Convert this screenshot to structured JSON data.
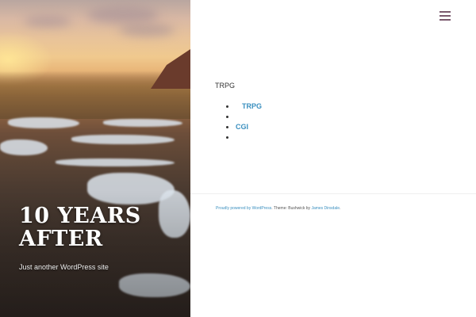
{
  "site": {
    "title": "10 YEARS AFTER",
    "tagline": "Just another WordPress site"
  },
  "header": {
    "menu_icon": "hamburger-icon"
  },
  "content": {
    "heading": "TRPG",
    "list_items": [
      {
        "label": "TRPG",
        "link": true
      },
      {
        "label": "",
        "link": false
      },
      {
        "label": "CGI",
        "link": true
      },
      {
        "label": "",
        "link": false
      }
    ]
  },
  "footer": {
    "powered_by": "Proudly powered by WordPress",
    "theme_text": ". Theme: Bushwick by ",
    "author": "James Dinsdale",
    "end": "."
  },
  "colors": {
    "link": "#3a8fbf",
    "menu_icon": "#7b5a6e",
    "text": "#333333"
  }
}
